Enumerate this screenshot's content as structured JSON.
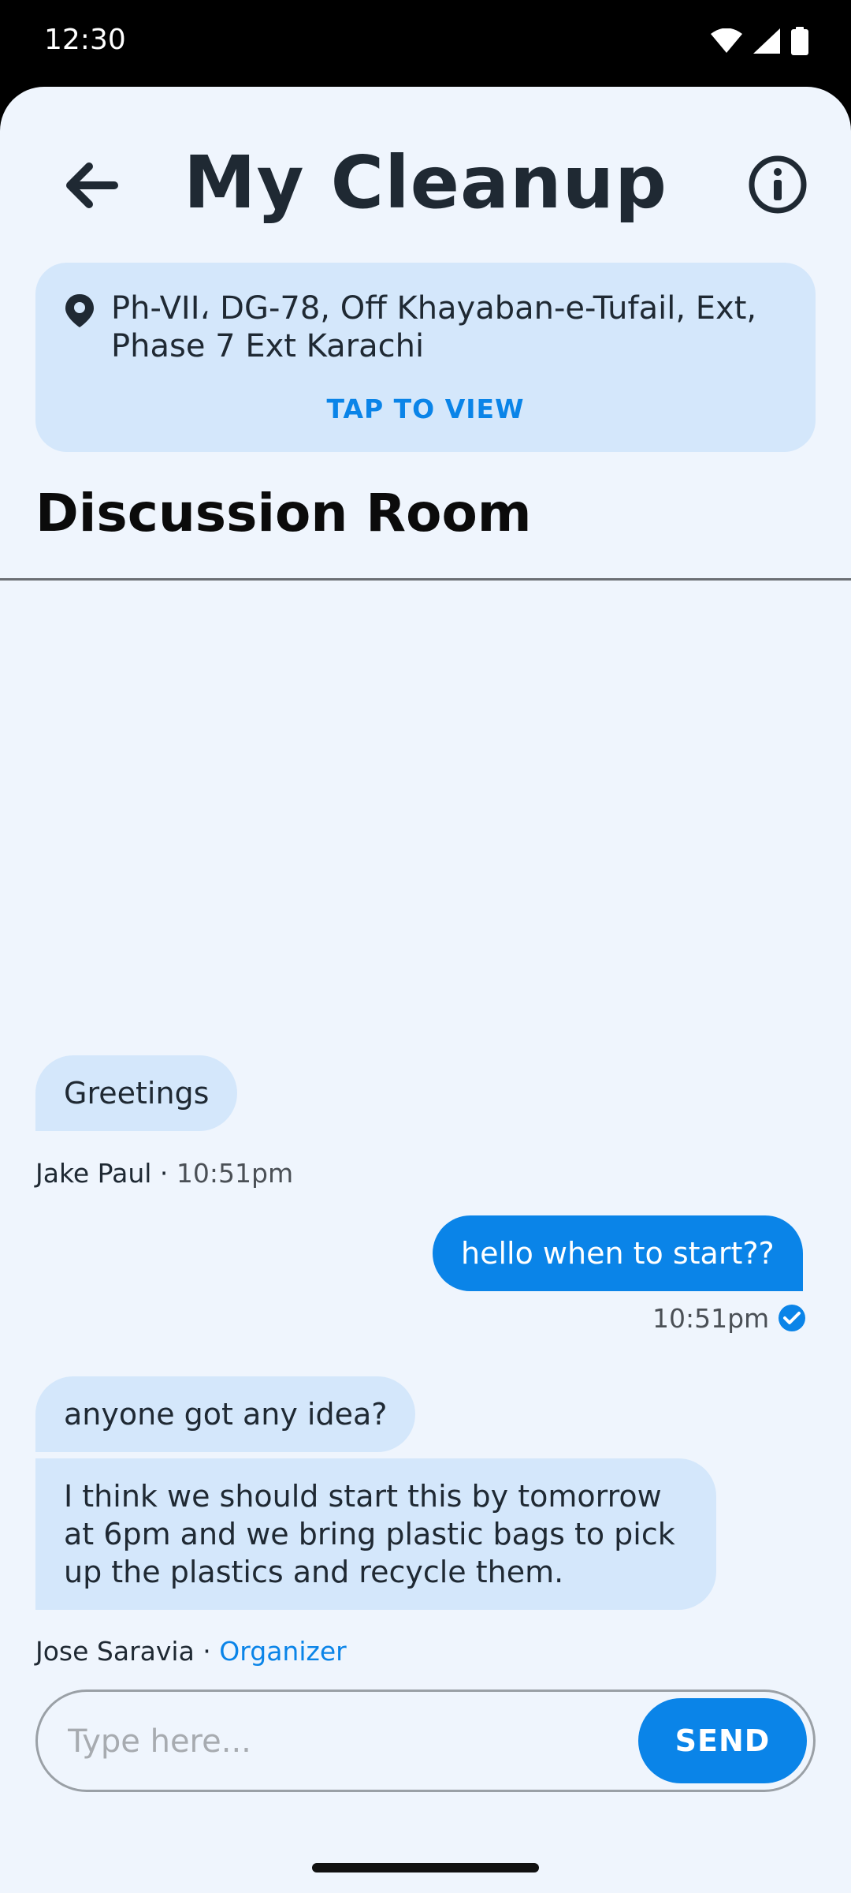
{
  "status_bar": {
    "time": "12:30"
  },
  "header": {
    "title": "My Cleanup"
  },
  "location": {
    "address": "Ph-VII، DG-78, Off Khayaban-e-Tufail, Ext, Phase 7 Ext Karachi",
    "action_label": "TAP TO VIEW"
  },
  "discussion": {
    "title": "Discussion Room",
    "messages": [
      {
        "text": "Greetings"
      },
      {
        "text": "hello when to start??"
      },
      {
        "text": "anyone got any idea?"
      },
      {
        "text": "I think we should start this by tomorrow at 6pm and we bring plastic bags to pick up the plastics and recycle them."
      }
    ],
    "meta": {
      "m1_sender": "Jake Paul",
      "m1_time": "10:51pm",
      "m2_time": "10:51pm",
      "m3_sender": "Jose Saravia",
      "m3_role": "Organizer",
      "separator": "·"
    }
  },
  "composer": {
    "placeholder": "Type here...",
    "send_label": "SEND"
  },
  "colors": {
    "accent": "#0a84e8",
    "bubble_incoming": "#d4e7fb",
    "background": "#eff5fd"
  }
}
